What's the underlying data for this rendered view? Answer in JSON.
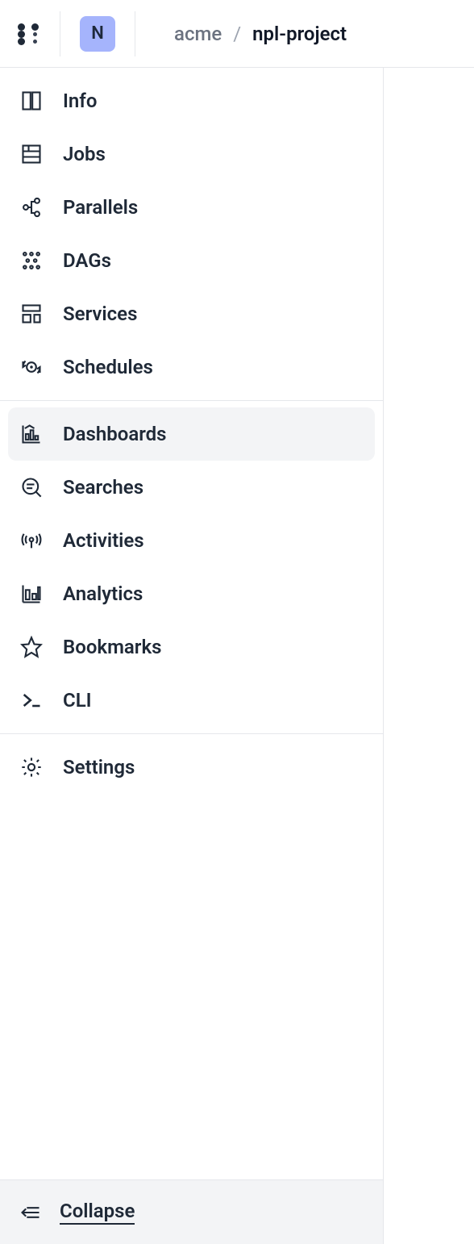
{
  "header": {
    "avatar_letter": "N",
    "breadcrumb": {
      "org": "acme",
      "separator": "/",
      "project": "npl-project"
    }
  },
  "sidebar": {
    "group1": [
      {
        "label": "Info"
      },
      {
        "label": "Jobs"
      },
      {
        "label": "Parallels"
      },
      {
        "label": "DAGs"
      },
      {
        "label": "Services"
      },
      {
        "label": "Schedules"
      }
    ],
    "group2": [
      {
        "label": "Dashboards",
        "active": true
      },
      {
        "label": "Searches"
      },
      {
        "label": "Activities"
      },
      {
        "label": "Analytics"
      },
      {
        "label": "Bookmarks"
      },
      {
        "label": "CLI"
      }
    ],
    "group3": [
      {
        "label": "Settings"
      }
    ],
    "collapse_label": "Collapse"
  }
}
